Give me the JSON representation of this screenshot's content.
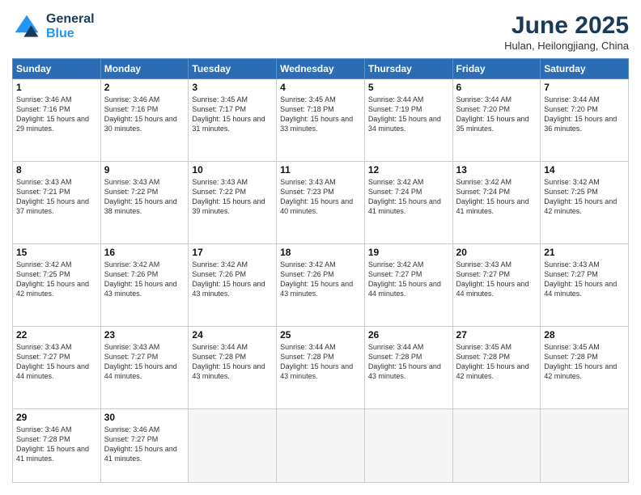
{
  "header": {
    "logo_line1": "General",
    "logo_line2": "Blue",
    "month": "June 2025",
    "location": "Hulan, Heilongjiang, China"
  },
  "days_of_week": [
    "Sunday",
    "Monday",
    "Tuesday",
    "Wednesday",
    "Thursday",
    "Friday",
    "Saturday"
  ],
  "weeks": [
    [
      {
        "day": "1",
        "sunrise": "3:46 AM",
        "sunset": "7:16 PM",
        "daylight": "15 hours and 29 minutes."
      },
      {
        "day": "2",
        "sunrise": "3:46 AM",
        "sunset": "7:16 PM",
        "daylight": "15 hours and 30 minutes."
      },
      {
        "day": "3",
        "sunrise": "3:45 AM",
        "sunset": "7:17 PM",
        "daylight": "15 hours and 31 minutes."
      },
      {
        "day": "4",
        "sunrise": "3:45 AM",
        "sunset": "7:18 PM",
        "daylight": "15 hours and 33 minutes."
      },
      {
        "day": "5",
        "sunrise": "3:44 AM",
        "sunset": "7:19 PM",
        "daylight": "15 hours and 34 minutes."
      },
      {
        "day": "6",
        "sunrise": "3:44 AM",
        "sunset": "7:20 PM",
        "daylight": "15 hours and 35 minutes."
      },
      {
        "day": "7",
        "sunrise": "3:44 AM",
        "sunset": "7:20 PM",
        "daylight": "15 hours and 36 minutes."
      }
    ],
    [
      {
        "day": "8",
        "sunrise": "3:43 AM",
        "sunset": "7:21 PM",
        "daylight": "15 hours and 37 minutes."
      },
      {
        "day": "9",
        "sunrise": "3:43 AM",
        "sunset": "7:22 PM",
        "daylight": "15 hours and 38 minutes."
      },
      {
        "day": "10",
        "sunrise": "3:43 AM",
        "sunset": "7:22 PM",
        "daylight": "15 hours and 39 minutes."
      },
      {
        "day": "11",
        "sunrise": "3:43 AM",
        "sunset": "7:23 PM",
        "daylight": "15 hours and 40 minutes."
      },
      {
        "day": "12",
        "sunrise": "3:42 AM",
        "sunset": "7:24 PM",
        "daylight": "15 hours and 41 minutes."
      },
      {
        "day": "13",
        "sunrise": "3:42 AM",
        "sunset": "7:24 PM",
        "daylight": "15 hours and 41 minutes."
      },
      {
        "day": "14",
        "sunrise": "3:42 AM",
        "sunset": "7:25 PM",
        "daylight": "15 hours and 42 minutes."
      }
    ],
    [
      {
        "day": "15",
        "sunrise": "3:42 AM",
        "sunset": "7:25 PM",
        "daylight": "15 hours and 42 minutes."
      },
      {
        "day": "16",
        "sunrise": "3:42 AM",
        "sunset": "7:26 PM",
        "daylight": "15 hours and 43 minutes."
      },
      {
        "day": "17",
        "sunrise": "3:42 AM",
        "sunset": "7:26 PM",
        "daylight": "15 hours and 43 minutes."
      },
      {
        "day": "18",
        "sunrise": "3:42 AM",
        "sunset": "7:26 PM",
        "daylight": "15 hours and 43 minutes."
      },
      {
        "day": "19",
        "sunrise": "3:42 AM",
        "sunset": "7:27 PM",
        "daylight": "15 hours and 44 minutes."
      },
      {
        "day": "20",
        "sunrise": "3:43 AM",
        "sunset": "7:27 PM",
        "daylight": "15 hours and 44 minutes."
      },
      {
        "day": "21",
        "sunrise": "3:43 AM",
        "sunset": "7:27 PM",
        "daylight": "15 hours and 44 minutes."
      }
    ],
    [
      {
        "day": "22",
        "sunrise": "3:43 AM",
        "sunset": "7:27 PM",
        "daylight": "15 hours and 44 minutes."
      },
      {
        "day": "23",
        "sunrise": "3:43 AM",
        "sunset": "7:27 PM",
        "daylight": "15 hours and 44 minutes."
      },
      {
        "day": "24",
        "sunrise": "3:44 AM",
        "sunset": "7:28 PM",
        "daylight": "15 hours and 43 minutes."
      },
      {
        "day": "25",
        "sunrise": "3:44 AM",
        "sunset": "7:28 PM",
        "daylight": "15 hours and 43 minutes."
      },
      {
        "day": "26",
        "sunrise": "3:44 AM",
        "sunset": "7:28 PM",
        "daylight": "15 hours and 43 minutes."
      },
      {
        "day": "27",
        "sunrise": "3:45 AM",
        "sunset": "7:28 PM",
        "daylight": "15 hours and 42 minutes."
      },
      {
        "day": "28",
        "sunrise": "3:45 AM",
        "sunset": "7:28 PM",
        "daylight": "15 hours and 42 minutes."
      }
    ],
    [
      {
        "day": "29",
        "sunrise": "3:46 AM",
        "sunset": "7:28 PM",
        "daylight": "15 hours and 41 minutes."
      },
      {
        "day": "30",
        "sunrise": "3:46 AM",
        "sunset": "7:27 PM",
        "daylight": "15 hours and 41 minutes."
      },
      null,
      null,
      null,
      null,
      null
    ]
  ]
}
